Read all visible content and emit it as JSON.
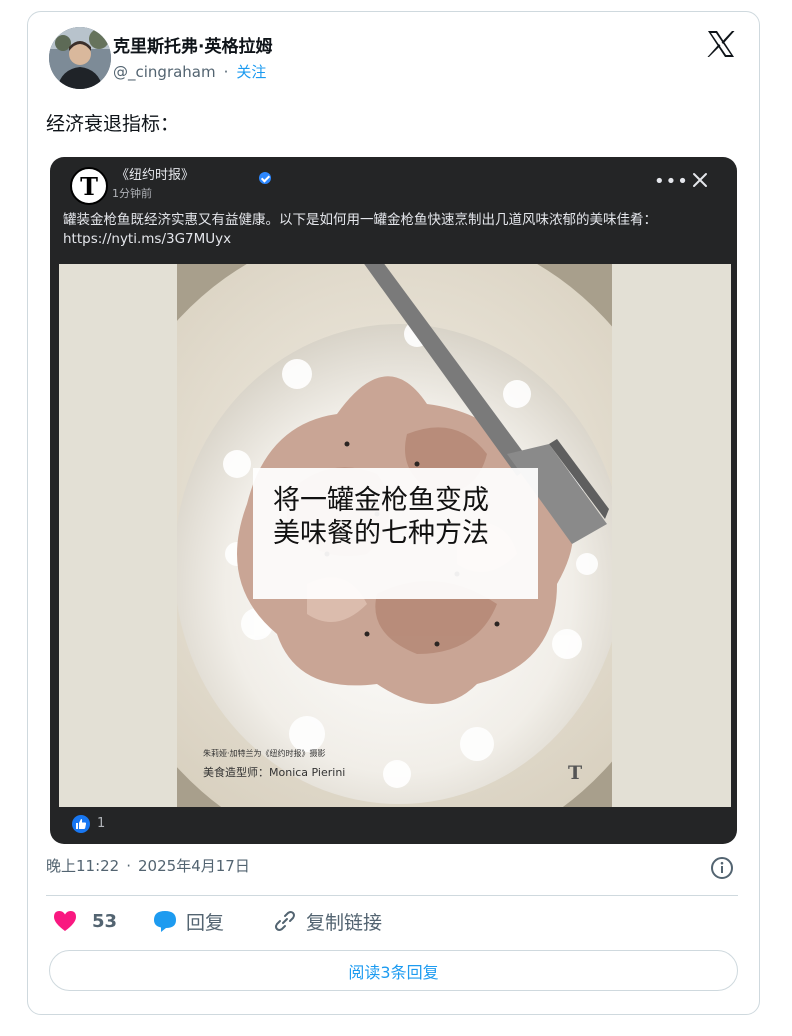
{
  "author": {
    "name": "克里斯托弗·英格拉姆",
    "handle": "@_cingraham",
    "separator": "·",
    "follow_label": "关注"
  },
  "tweet": {
    "text": "经济衰退指标："
  },
  "embedded_post": {
    "logo_letter": "T",
    "page_name": "《纽约时报》",
    "time": "1分钟前",
    "more_icon": "•••",
    "text_line1": "罐装金枪鱼既经济实惠又有益健康。以下是如何用一罐金枪鱼快速烹制出几道风味浓郁的美味佳肴：",
    "text_line2": "https://nyti.ms/3G7MUyx",
    "image": {
      "overlay_line1": "将一罐金枪鱼变成",
      "overlay_line2": "美味餐的七种方法",
      "photo_credit": "朱莉娅·加特兰为《纽约时报》摄影",
      "stylist": "美食造型师：Monica Pierini",
      "mark": "T"
    },
    "like_count": "1"
  },
  "meta": {
    "time": "晚上11:22",
    "separator": "·",
    "date": "2025年4月17日"
  },
  "actions": {
    "likes_count": "53",
    "reply_label": "回复",
    "copy_link_label": "复制链接",
    "read_replies_label": "阅读3条回复"
  },
  "colors": {
    "accent": "#1d9bf0",
    "heart": "#f91880",
    "fb_dark": "#242526",
    "fb_blue": "#1877f2"
  }
}
